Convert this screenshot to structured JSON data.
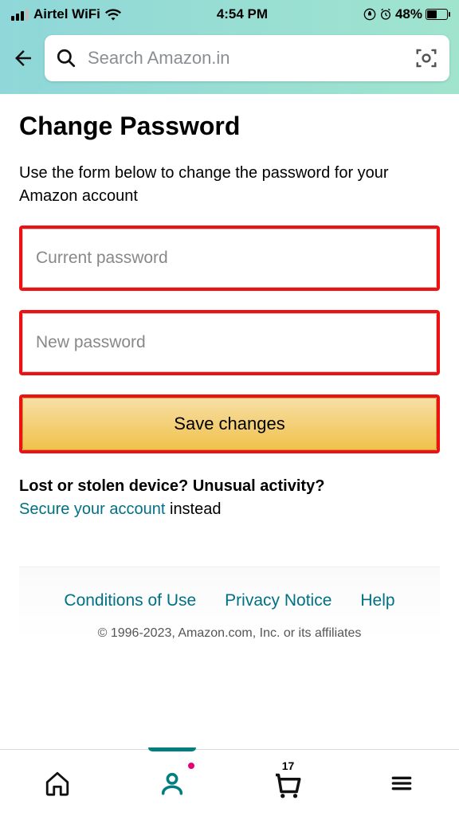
{
  "statusbar": {
    "carrier": "Airtel WiFi",
    "time": "4:54 PM",
    "battery_pct": "48%"
  },
  "header": {
    "search_placeholder": "Search Amazon.in"
  },
  "page": {
    "title": "Change Password",
    "description": "Use the form below to change the password for your Amazon account",
    "current_pw_placeholder": "Current password",
    "new_pw_placeholder": "New password",
    "save_label": "Save changes",
    "lost_title": "Lost or stolen device? Unusual activity?",
    "secure_link": "Secure your account",
    "instead_text": " instead"
  },
  "footer": {
    "conditions": "Conditions of Use",
    "privacy": "Privacy Notice",
    "help": "Help",
    "copyright": "© 1996-2023, Amazon.com, Inc. or its affiliates"
  },
  "nav": {
    "cart_count": "17"
  }
}
